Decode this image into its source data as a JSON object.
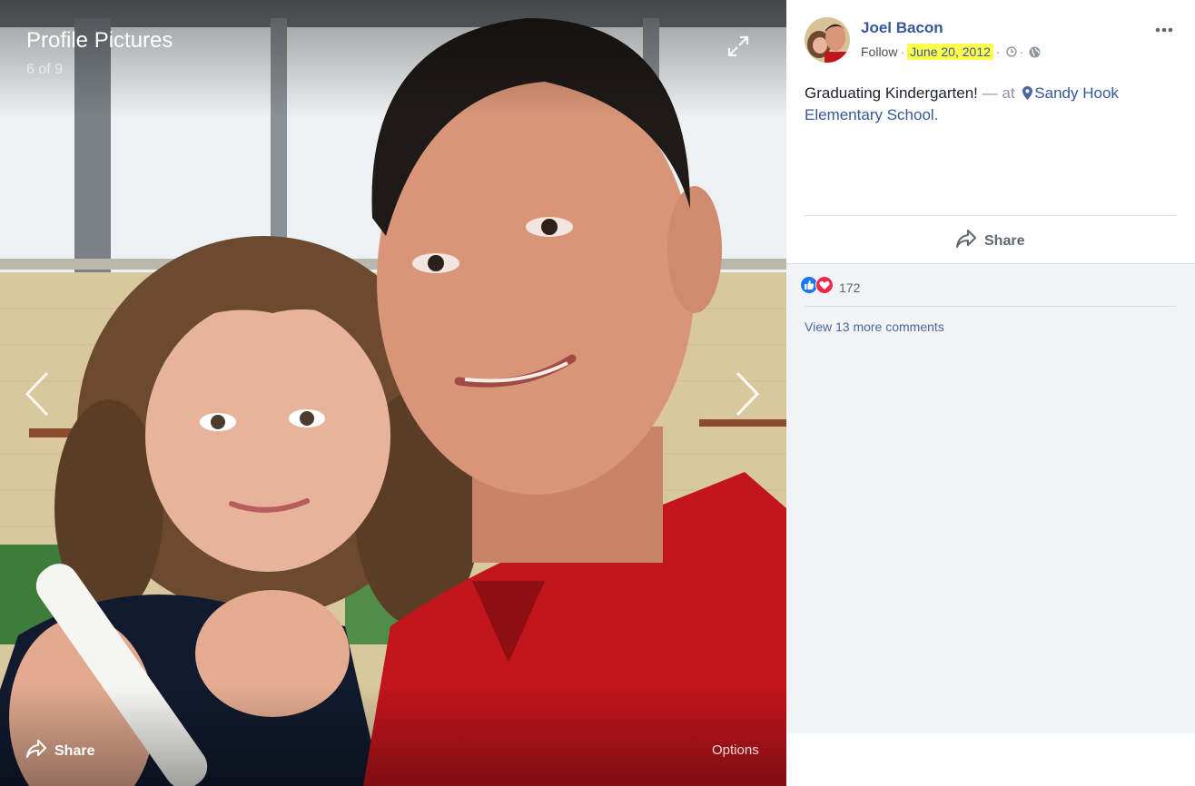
{
  "viewer": {
    "album_title": "Profile Pictures",
    "counter": "6 of 9",
    "share_label": "Share",
    "options_label": "Options",
    "icons": {
      "expand": "expand-icon",
      "prev": "chevron-left-icon",
      "next": "chevron-right-icon",
      "share": "share-arrow-icon"
    }
  },
  "post": {
    "author": "Joel Bacon",
    "follow_label": "Follow",
    "separator": "·",
    "date": "June 20, 2012",
    "caption_text": "Graduating Kindergarten!",
    "caption_at": "— at",
    "place": "Sandy Hook Elementary School.",
    "share_label": "Share",
    "reaction_count": "172",
    "view_more_comments": "View 13 more comments",
    "icons": {
      "more": "more-horizontal-icon",
      "clock": "clock-icon",
      "audience": "globe-icon",
      "place": "map-pin-icon",
      "like": "like-reaction-icon",
      "love": "love-reaction-icon"
    }
  },
  "colors": {
    "link": "#365899",
    "date_highlight": "#ffff4d",
    "comments_bg": "#f2f3f5",
    "like_blue": "#1877f2",
    "love_red": "#f02849"
  }
}
